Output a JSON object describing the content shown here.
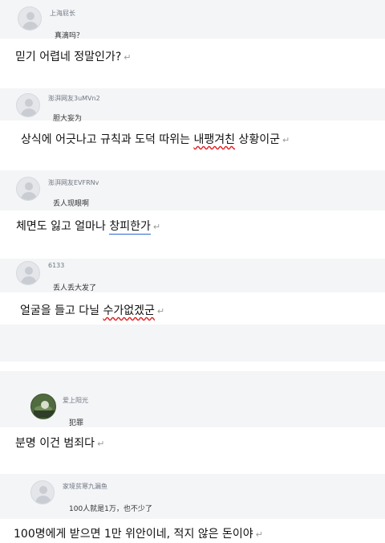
{
  "comments": [
    {
      "user": "上海屁长",
      "comment": "真滴吗？",
      "translation": {
        "prefix": "믿기 어렵네 정말인가?",
        "marked": "",
        "suffix": ""
      }
    },
    {
      "user": "澎湃网友3uMVn2",
      "comment": "胆大妄为",
      "translation": {
        "prefix": "상식에 어긋나고 규칙과 도덕 따위는 ",
        "marked": "내팽겨친",
        "suffix": " 상황이군"
      }
    },
    {
      "user": "澎湃网友EVFRNv",
      "comment": "丢人现眼啊",
      "translation": {
        "prefix": "체면도 잃고 얼마나 ",
        "marked": "창피한가",
        "suffix": ""
      }
    },
    {
      "user": "6133",
      "comment": "丢人丢大发了",
      "translation": {
        "prefix": "얼굴을 들고 다닐 ",
        "marked": "수가없겠군",
        "suffix": ""
      }
    },
    {
      "user": "爱上阳光",
      "comment": "犯罪",
      "translation": {
        "prefix": "분명 이건 범죄다",
        "marked": "",
        "suffix": ""
      }
    },
    {
      "user": "家境贫寒九漏鱼",
      "comment": "100人就是1万，也不少了",
      "translation": {
        "prefix": "100명에게 받으면 1만 위안이네, 적지 않은 돈이야",
        "marked": "",
        "suffix": ""
      }
    }
  ],
  "paragraph_mark": "↵"
}
